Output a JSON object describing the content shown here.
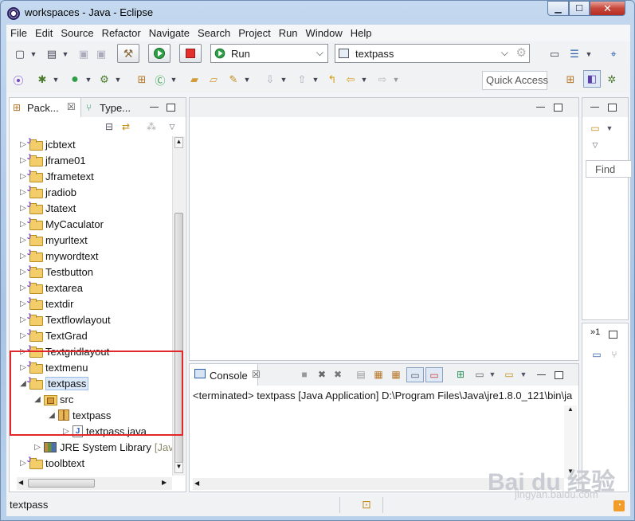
{
  "window": {
    "title": "workspaces - Java - Eclipse",
    "minimize": "▁",
    "maximize": "☐",
    "close": "✕"
  },
  "menubar": {
    "items": [
      "File",
      "Edit",
      "Source",
      "Refactor",
      "Navigate",
      "Search",
      "Project",
      "Run",
      "Window",
      "Help"
    ]
  },
  "toolbar": {
    "run_config": "Run",
    "launch_target": "textpass",
    "quick_access_placeholder": "Quick Access"
  },
  "package_explorer": {
    "tab_label": "Pack...",
    "other_tab_label": "Type...",
    "projects": [
      "jcbtext",
      "jframe01",
      "Jframetext",
      "jradiob",
      "Jtatext",
      "MyCaculator",
      "myurltext",
      "mywordtext",
      "Testbutton",
      "textarea",
      "textdir",
      "Textflowlayout",
      "TextGrad",
      "Textgridlayout",
      "textmenu"
    ],
    "expanded_project": "textpass",
    "src_folder": "src",
    "package_name": "textpass",
    "java_file": "textpass.java",
    "library": "JRE System Library",
    "library_suffix": "[Java",
    "after_project": "toolbtext"
  },
  "outline": {
    "find_placeholder": "Find",
    "badge": "»1"
  },
  "console": {
    "tab_label": "Console",
    "output": "<terminated> textpass [Java Application] D:\\Program Files\\Java\\jre1.8.0_121\\bin\\ja"
  },
  "status": {
    "text": "textpass"
  },
  "watermark": {
    "brand": "Bai du 经验",
    "url": "jingyan.baidu.com"
  }
}
